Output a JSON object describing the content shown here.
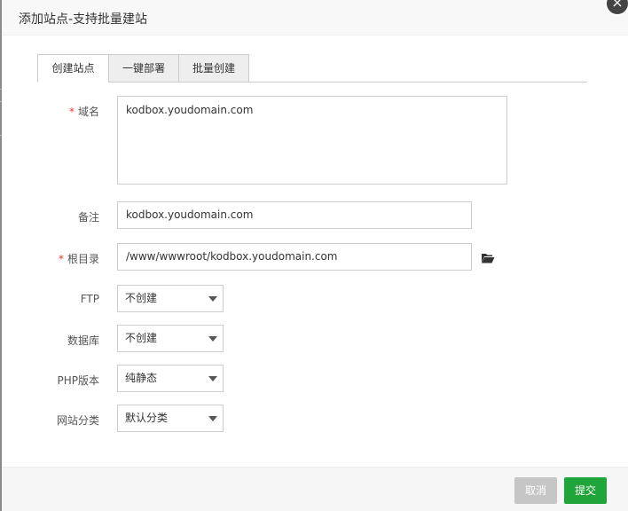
{
  "dialog": {
    "title": "添加站点-支持批量建站",
    "close_icon": "×"
  },
  "tabs": [
    {
      "label": "创建站点",
      "active": true
    },
    {
      "label": "一键部署",
      "active": false
    },
    {
      "label": "批量创建",
      "active": false
    }
  ],
  "form": {
    "domain": {
      "label": "域名",
      "required": true,
      "value": "kodbox.youdomain.com"
    },
    "remark": {
      "label": "备注",
      "value": "kodbox.youdomain.com"
    },
    "root_dir": {
      "label": "根目录",
      "required": true,
      "value": "/www/wwwroot/kodbox.youdomain.com",
      "icon": "folder-open-icon"
    },
    "ftp": {
      "label": "FTP",
      "selected": "不创建"
    },
    "database": {
      "label": "数据库",
      "selected": "不创建"
    },
    "php_version": {
      "label": "PHP版本",
      "selected": "纯静态"
    },
    "site_category": {
      "label": "网站分类",
      "selected": "默认分类"
    }
  },
  "footer": {
    "cancel_label": "取消",
    "submit_label": "提交"
  },
  "colors": {
    "submit": "#20a53a",
    "cancel": "#c6c6c6",
    "required": "#e53935"
  }
}
